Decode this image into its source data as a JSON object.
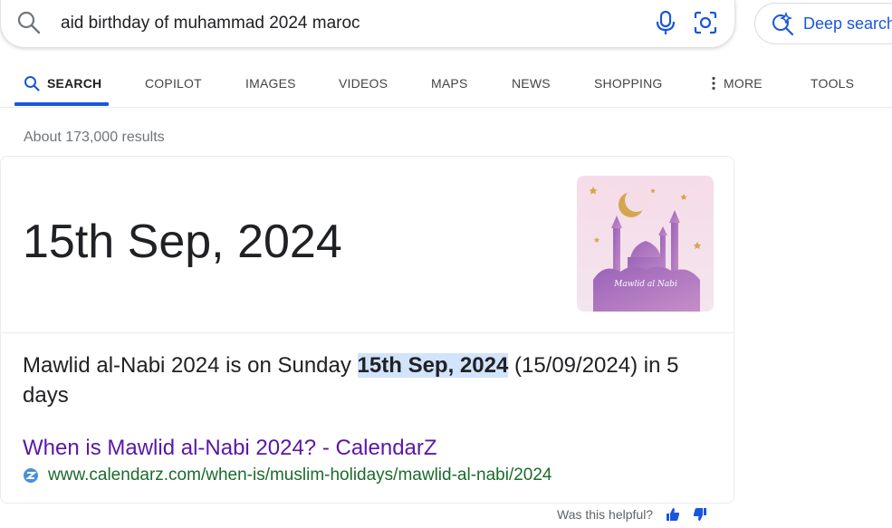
{
  "search": {
    "query": "aid birthday of muhammad 2024 maroc",
    "deep_search_label": "Deep search"
  },
  "tabs": [
    {
      "label": "SEARCH",
      "active": true
    },
    {
      "label": "COPILOT"
    },
    {
      "label": "IMAGES"
    },
    {
      "label": "VIDEOS"
    },
    {
      "label": "MAPS"
    },
    {
      "label": "NEWS"
    },
    {
      "label": "SHOPPING"
    },
    {
      "label": "MORE"
    },
    {
      "label": "TOOLS"
    }
  ],
  "results_count": "About 173,000 results",
  "answer": {
    "big_date": "15th Sep, 2024",
    "image_text": "Mawlid al Nabi",
    "snippet_before": "Mawlid al-Nabi 2024 is on Sunday ",
    "snippet_highlight": "15th Sep, 2024",
    "snippet_after": " (15/09/2024) in 5 days",
    "link_title": "When is Mawlid al-Nabi 2024? - CalendarZ",
    "link_url": "www.calendarz.com/when-is/muslim-holidays/mawlid-al-nabi/2024"
  },
  "feedback": {
    "label": "Was this helpful?"
  },
  "colors": {
    "accent": "#1a56db",
    "link_title": "#5a17a9",
    "link_url": "#1b6b2b",
    "highlight": "#d2e3fc"
  }
}
